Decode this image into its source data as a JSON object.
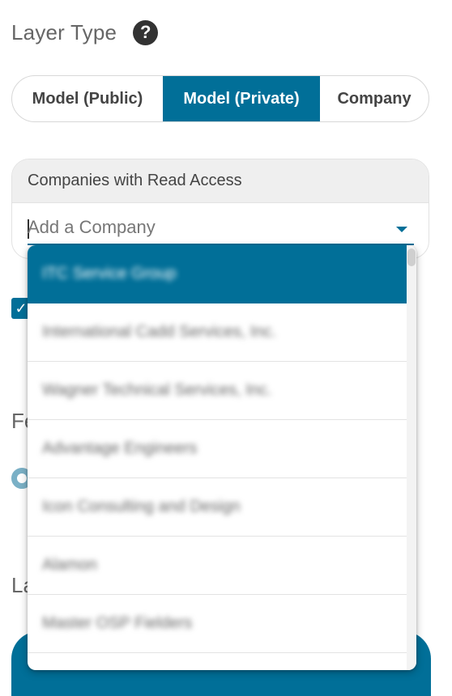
{
  "layer_type": {
    "title": "Layer Type",
    "help_icon": "question-mark-circle-icon",
    "options": [
      {
        "label": "Model (Public)",
        "selected": false
      },
      {
        "label": "Model (Private)",
        "selected": true
      },
      {
        "label": "Company",
        "selected": false
      }
    ]
  },
  "read_access": {
    "header": "Companies with Read Access",
    "input_value": "",
    "placeholder": "Add a Company",
    "dropdown_icon": "caret-down-icon"
  },
  "background": {
    "checkbox_icon": "checkmark-icon",
    "label_1_fragment": "Fe",
    "label_2_fragment": "La"
  },
  "dropdown": {
    "items": [
      {
        "label": "ITC Service Group",
        "selected": true
      },
      {
        "label": "International Cadd Services, Inc.",
        "selected": false
      },
      {
        "label": "Wagner Technical Services, Inc.",
        "selected": false
      },
      {
        "label": "Advantage Engineers",
        "selected": false
      },
      {
        "label": "Icon Consulting and Design",
        "selected": false
      },
      {
        "label": "Alamon",
        "selected": false
      },
      {
        "label": "Master OSP Fielders",
        "selected": false
      }
    ]
  },
  "colors": {
    "accent": "#016f98",
    "accent_light": "#7ab0c6"
  }
}
